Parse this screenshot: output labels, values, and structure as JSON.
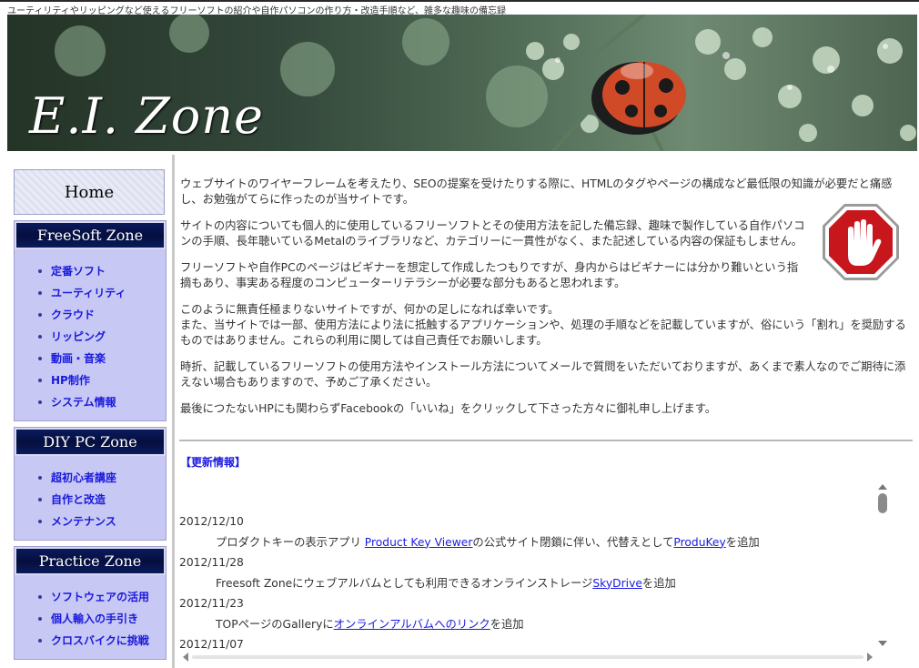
{
  "header": {
    "tagline": "ユーティリティやリッピングなど使えるフリーソフトの紹介や自作パソコンの作り方・改造手順など、雑多な趣味の備忘録",
    "logo": "E.I. Zone"
  },
  "sidebar": {
    "home_label": "Home",
    "zones": [
      {
        "title": "FreeSoft Zone",
        "items": [
          "定番ソフト",
          "ユーティリティ",
          "クラウド",
          "リッピング",
          "動画・音楽",
          "HP制作",
          "システム情報"
        ]
      },
      {
        "title": "DIY PC Zone",
        "items": [
          "超初心者講座",
          "自作と改造",
          "メンテナンス"
        ]
      },
      {
        "title": "Practice Zone",
        "items": [
          "ソフトウェアの活用",
          "個人輸入の手引き",
          "クロスバイクに挑戦"
        ]
      }
    ]
  },
  "main": {
    "paragraphs": [
      "ウェブサイトのワイヤーフレームを考えたり、SEOの提案を受けたりする際に、HTMLのタグやページの構成など最低限の知識が必要だと痛感し、お勉強がてらに作ったのが当サイトです。",
      "サイトの内容についても個人的に使用しているフリーソフトとその使用方法を記した備忘録、趣味で製作している自作パソコンの手順、長年聴いているMetalのライブラリなど、カテゴリーに一貫性がなく、また記述している内容の保証もしません。",
      "フリーソフトや自作PCのページはビギナーを想定して作成したつもりですが、身内からはビギナーには分かり難いという指摘もあり、事実ある程度のコンピューターリテラシーが必要な部分もあると思われます。",
      "このように無責任極まりないサイトですが、何かの足しになれば幸いです。",
      "また、当サイトでは一部、使用方法により法に抵触するアプリケーションや、処理の手順などを記載していますが、俗にいう「割れ」を奨励するものではありません。これらの利用に関しては自己責任でお願いします。",
      "時折、記載しているフリーソフトの使用方法やインストール方法についてメールで質問をいただいておりますが、あくまで素人なのでご期待に添えない場合もありますので、予めご了承ください。",
      "最後につたないHPにも関わらずFacebookの「いいね」をクリックして下さった方々に御礼申し上げます。"
    ],
    "updates_title": "【更新情報】",
    "updates": [
      {
        "date": "2012/12/10",
        "before": "プロダクトキーの表示アプリ ",
        "link1": "Product Key Viewer",
        "middle": "の公式サイト閉鎖に伴い、代替えとして",
        "link2": "ProduKey",
        "after": "を追加"
      },
      {
        "date": "2012/11/28",
        "before": "Freesoft Zoneにウェブアルバムとしても利用できるオンラインストレージ",
        "link1": "SkyDrive",
        "after": "を追加"
      },
      {
        "date": "2012/11/23",
        "before": "TOPページのGalleryに",
        "link1": "オンラインアルバムへのリンク",
        "after": "を追加"
      },
      {
        "date": "2012/11/07"
      }
    ]
  },
  "icons": {
    "stop": "stop-hand-icon",
    "ladybug": "ladybug-image"
  },
  "colors": {
    "nav_link": "#1a1adc",
    "zone_header": "#0a1a5c",
    "zone_bg": "#c8c8f4",
    "stop_red": "#c8161d"
  }
}
